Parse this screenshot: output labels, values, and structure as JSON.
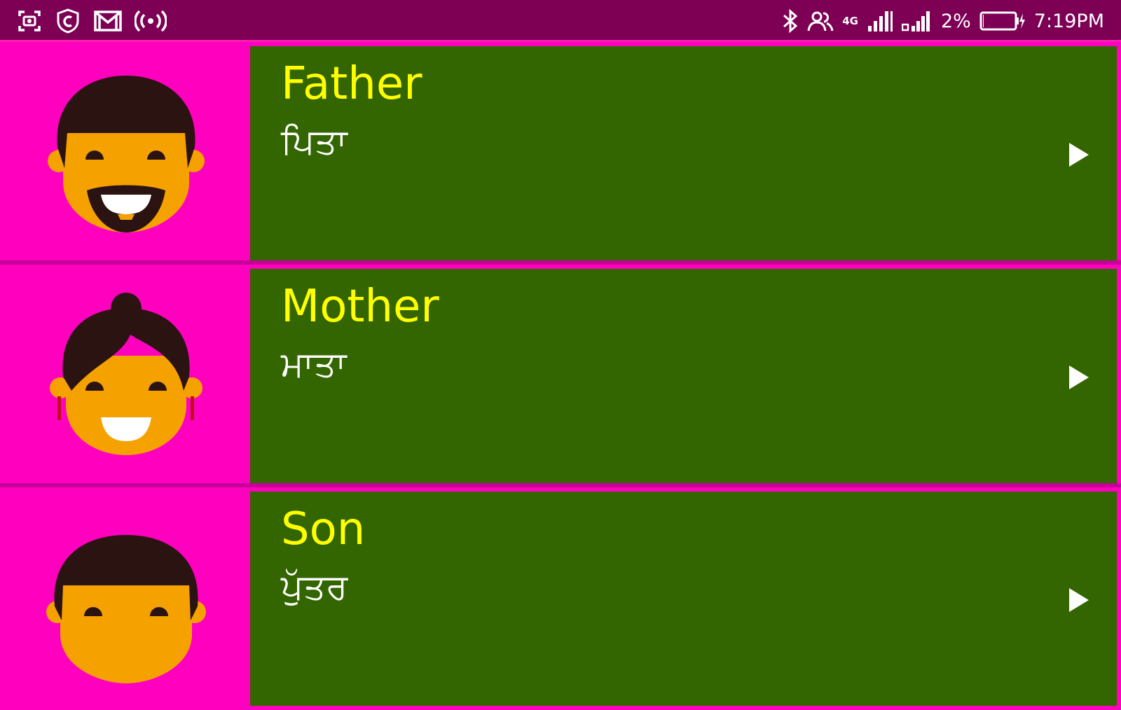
{
  "status_bar": {
    "left_icons": [
      "screenshot-icon",
      "copyright-icon",
      "gmail-icon",
      "hotspot-icon"
    ],
    "right_icons": [
      "bluetooth-icon",
      "contacts-icon",
      "4g-icon",
      "signal-icon",
      "signal-icon"
    ],
    "network_label": "4G",
    "battery_percent": "2%",
    "battery_level": 0.02,
    "time": "7:19PM",
    "colors": {
      "background": "#7d0055",
      "foreground": "#ffffff"
    }
  },
  "list": {
    "items": [
      {
        "word": "Father",
        "translation": "ਪਿਤਾ",
        "avatar": "father-avatar-icon",
        "action": "play-icon"
      },
      {
        "word": "Mother",
        "translation": "ਮਾਤਾ",
        "avatar": "mother-avatar-icon",
        "action": "play-icon"
      },
      {
        "word": "Son",
        "translation": "ਪੁੱਤਰ",
        "avatar": "son-avatar-icon",
        "action": "play-icon"
      }
    ]
  },
  "colors": {
    "page_background": "#ff00bf",
    "card_background": "#336600",
    "word_color": "#ffff00",
    "translation_color": "#ffffff",
    "skin": "#f5a100",
    "hair": "#2b1311"
  }
}
